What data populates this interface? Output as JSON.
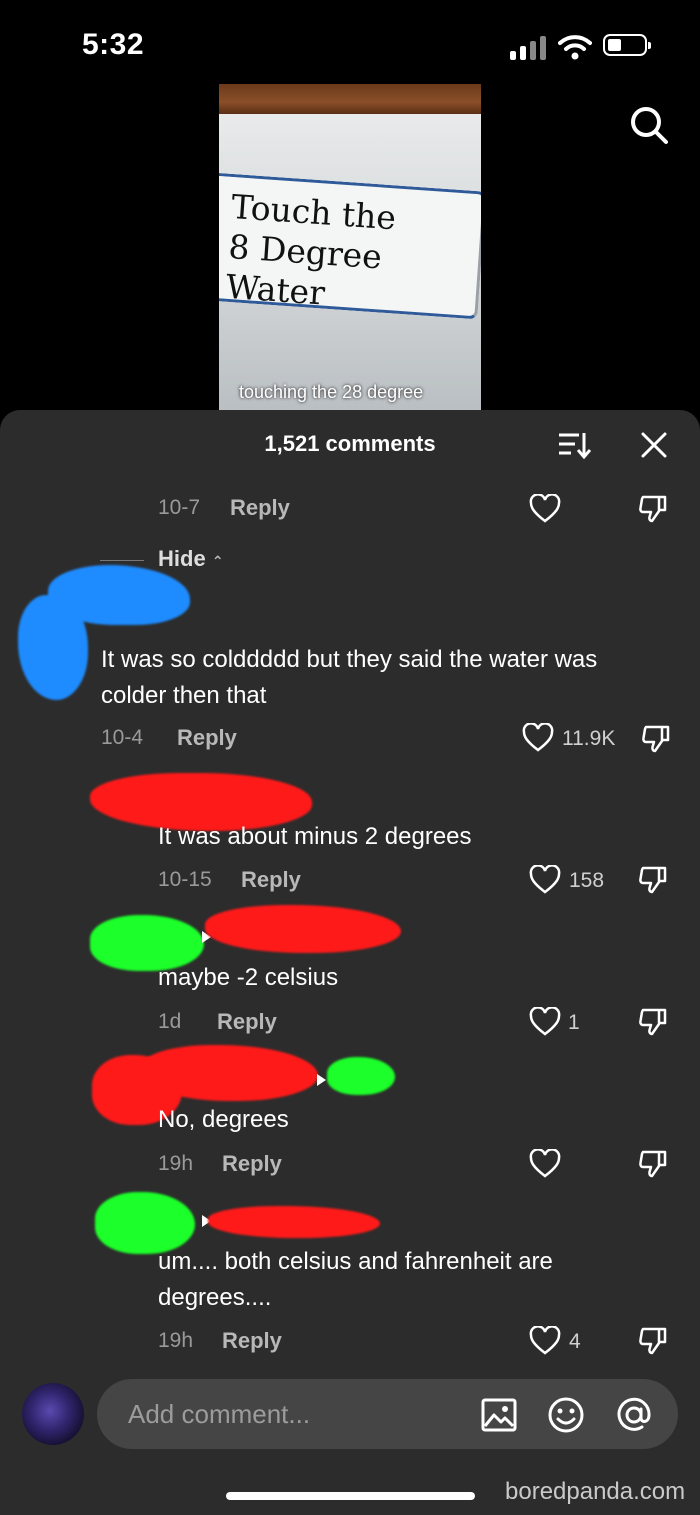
{
  "status_bar": {
    "time": "5:32"
  },
  "video": {
    "sign_text": "Touch the\n8 Degree Water",
    "caption": "touching the 28 degree"
  },
  "comments_header": {
    "count_label": "1,521 comments"
  },
  "hide_label": "Hide",
  "comments": [
    {
      "date": "10-7",
      "reply": "Reply",
      "likes": ""
    },
    {
      "text": "It was so colddddd but they said the water was colder then that",
      "date": "10-4",
      "reply": "Reply",
      "likes": "11.9K"
    },
    {
      "text": "It was about minus 2 degrees",
      "date": "10-15",
      "reply": "Reply",
      "likes": "158"
    },
    {
      "text": "maybe -2 celsius",
      "date": "1d",
      "reply": "Reply",
      "likes": "1"
    },
    {
      "text": "No, degrees",
      "date": "19h",
      "reply": "Reply",
      "likes": ""
    },
    {
      "text": "um.... both celsius and fahrenheit are degrees....",
      "date": "19h",
      "reply": "Reply",
      "likes": "4"
    }
  ],
  "composer": {
    "placeholder": "Add comment..."
  },
  "watermark": "boredpanda.com",
  "colors": {
    "sheet": "#2c2c2c",
    "input": "#454545",
    "redact_blue": "#1e8cff",
    "redact_red": "#ff1a1a",
    "redact_green": "#1cff2a"
  }
}
